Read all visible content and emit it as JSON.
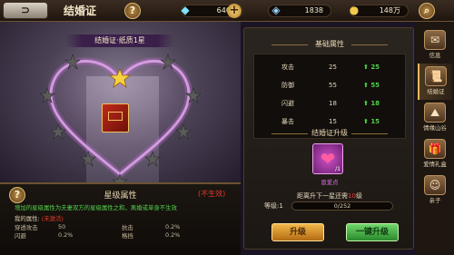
{
  "top_bar": {
    "back_label": "⊃",
    "title": "结婚证",
    "help_label": "?",
    "gold_label": "?",
    "diamonds": "6406",
    "bound_diamonds": "1838",
    "coins": "148万"
  },
  "scene": {
    "cert_label": "结婚证·纸质1星"
  },
  "star_attr": {
    "help_label": "?",
    "title": "星级属性",
    "status": "(不生效)",
    "description": "增加的星级属性为夫妻双方的星级属性之和，离婚或单身不生效",
    "my_attr_label": "我的属性:",
    "my_attr_status": "(未激活)",
    "rows": [
      {
        "name1": "穿透攻击",
        "val1": "50",
        "name2": "抗击",
        "val2": "0.2%"
      },
      {
        "name1": "闪避",
        "val1": "0.2%",
        "name2": "格挡",
        "val2": "0.2%"
      }
    ]
  },
  "basic_attr": {
    "title": "基础属性",
    "rows": [
      {
        "name": "攻击",
        "value": "25",
        "bonus": "25"
      },
      {
        "name": "防御",
        "value": "55",
        "bonus": "55"
      },
      {
        "name": "闪避",
        "value": "18",
        "bonus": "18"
      },
      {
        "name": "暴击",
        "value": "15",
        "bonus": "15"
      }
    ]
  },
  "upgrade": {
    "title": "结婚证升级",
    "item_name": "恩爱点",
    "item_count": "/1",
    "next_prefix": "距离升下一星还需",
    "next_value": "10",
    "next_suffix": "级",
    "level_label": "等级:1",
    "progress_text": "0/252",
    "progress": 0,
    "btn_upgrade": "升级",
    "btn_oneclick": "一键升级"
  },
  "side_tabs": [
    {
      "label": "信息",
      "icon": "info-icon"
    },
    {
      "label": "结婚证",
      "icon": "certificate-icon"
    },
    {
      "label": "情缘山谷",
      "icon": "valley-icon"
    },
    {
      "label": "爱情礼盒",
      "icon": "gift-box-icon"
    },
    {
      "label": "亲子",
      "icon": "child-icon"
    }
  ]
}
